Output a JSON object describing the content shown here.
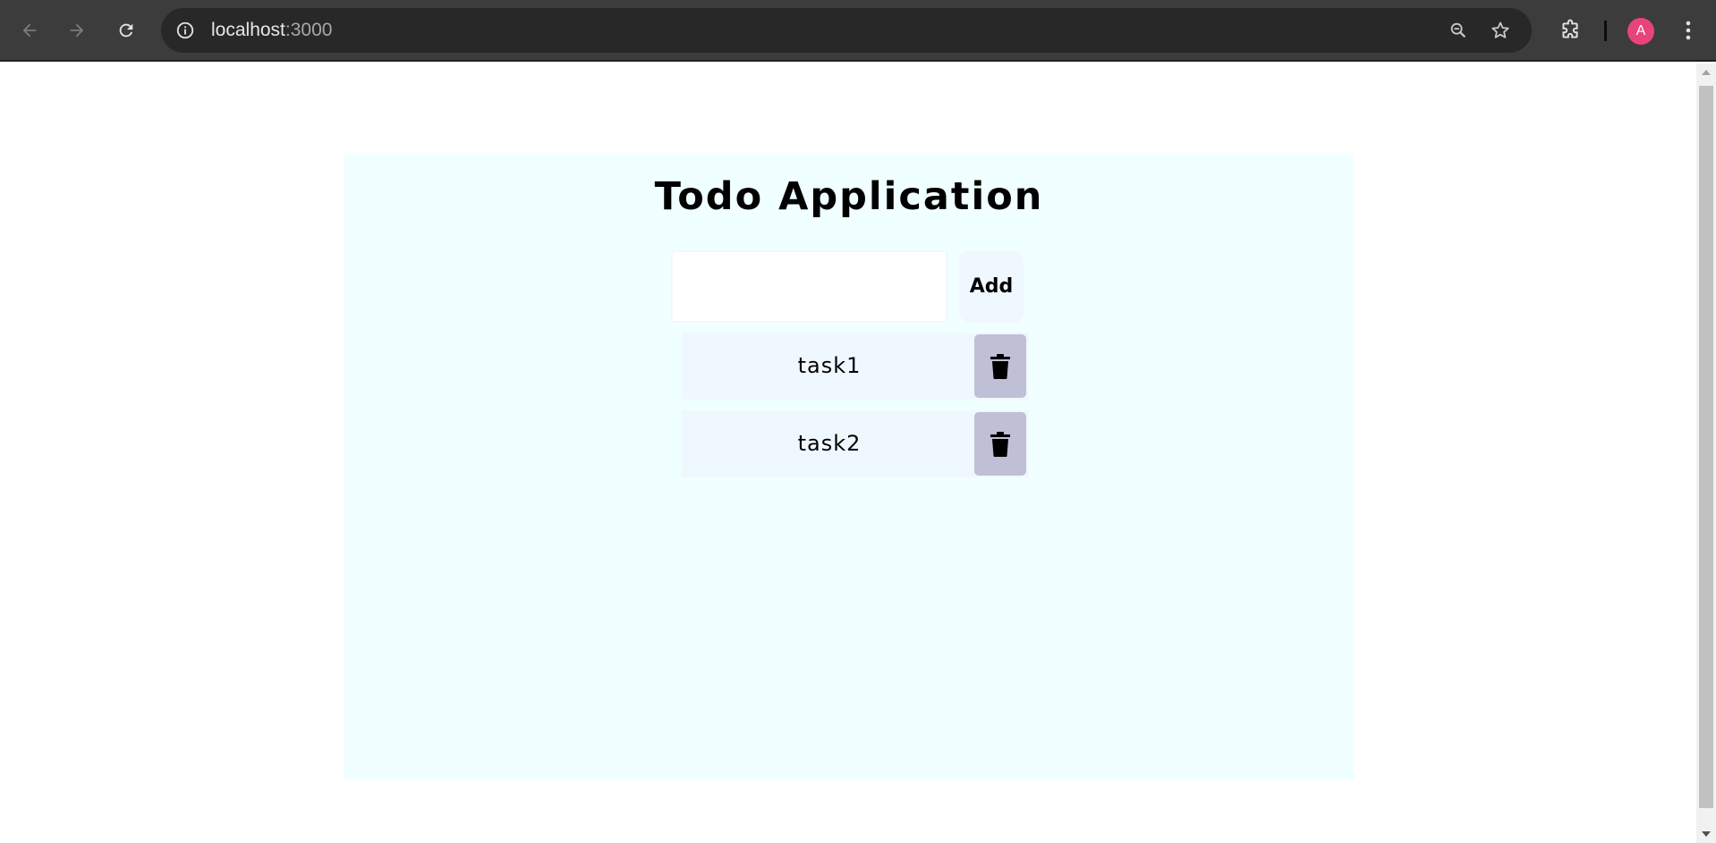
{
  "browser": {
    "url_host": "localhost",
    "url_port": ":3000",
    "avatar_letter": "A",
    "icons": {
      "back": "arrow-left-icon",
      "forward": "arrow-right-icon",
      "reload": "reload-icon",
      "site_info": "info-circle-icon",
      "zoom": "zoom-out-icon",
      "bookmark": "star-icon",
      "extensions": "puzzle-icon",
      "menu": "kebab-menu-icon"
    }
  },
  "app": {
    "title": "Todo Application",
    "input_value": "",
    "add_label": "Add",
    "tasks": [
      {
        "label": "task1"
      },
      {
        "label": "task2"
      }
    ],
    "delete_icon": "trash-icon",
    "colors": {
      "container_bg": "#f0ffff",
      "item_bg": "#f0f8ff",
      "delete_bg": "#bfbfd6"
    }
  }
}
